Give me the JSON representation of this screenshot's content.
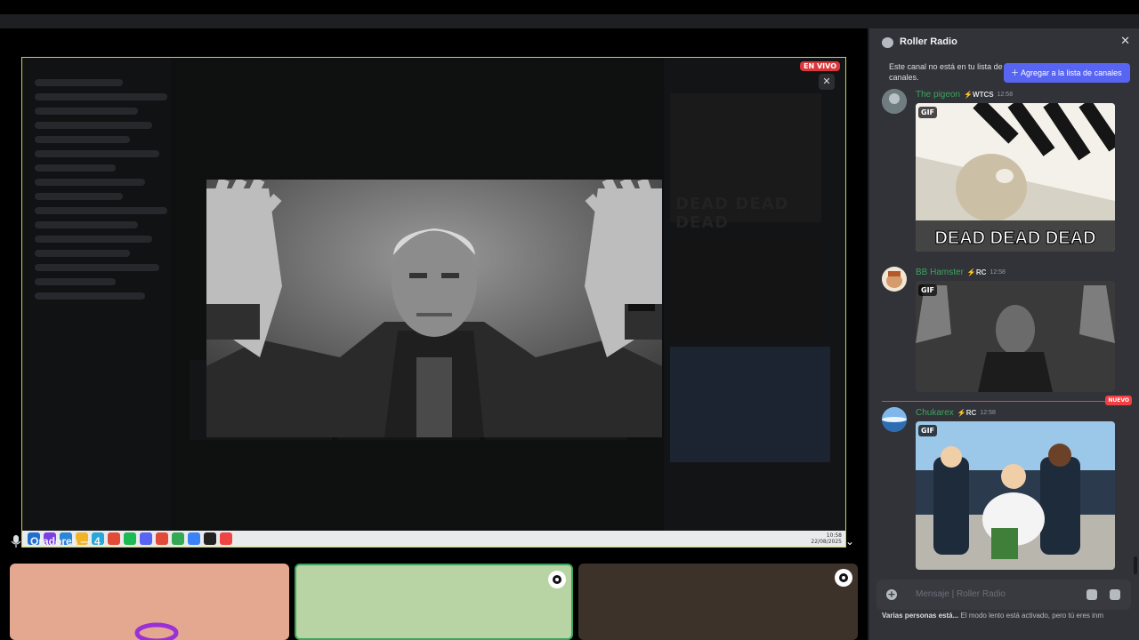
{
  "live_badge": "EN VIVO",
  "clock": {
    "time": "10:58",
    "date": "22/08/2025"
  },
  "speakers": {
    "label": "Oradores — 4"
  },
  "panel": {
    "title": "Roller Radio",
    "notice": "Este canal no está en tu lista de canales.",
    "add_button": "Agregar a la lista de canales"
  },
  "messages": [
    {
      "user": "The pigeon",
      "tag": "WTCS",
      "time": "12:58",
      "gif_label": "GIF",
      "gif_caption": "DEAD DEAD DEAD"
    },
    {
      "user": "BB Hamster",
      "tag": "RC",
      "time": "12:58",
      "gif_label": "GIF"
    },
    {
      "user": "Chukarex",
      "tag": "RC",
      "time": "12:58",
      "gif_label": "GIF"
    }
  ],
  "new_label": "NUEVO",
  "input": {
    "placeholder": "Mensaje  | Roller Radio"
  },
  "typing": {
    "who": "Varias personas está...",
    "rest": "El modo lento está activado, pero tú eres inm"
  },
  "colors": {
    "accent": "#5865f2",
    "live": "#da373c",
    "username": "#3ba55d",
    "stream_border": "#c9d34a"
  }
}
